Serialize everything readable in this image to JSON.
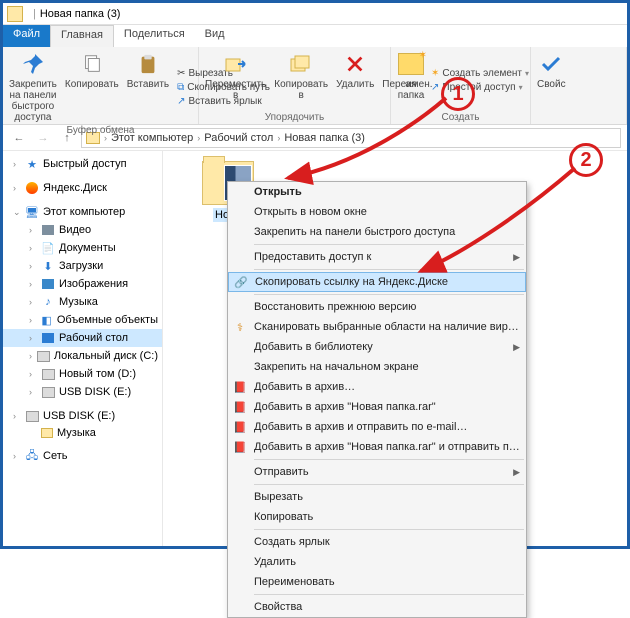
{
  "title": {
    "folder_name": "Новая папка (3)"
  },
  "tabs": {
    "file": "Файл",
    "home": "Главная",
    "share": "Поделиться",
    "view": "Вид"
  },
  "ribbon": {
    "clipboard": {
      "pin": "Закрепить на панели\nбыстрого доступа",
      "copy": "Копировать",
      "paste": "Вставить",
      "cut": "Вырезать",
      "copypath": "Скопировать путь",
      "pasteshort": "Вставить ярлык",
      "label": "Буфер обмена"
    },
    "organize": {
      "move": "Переместить\nв",
      "copyto": "Копировать\nв",
      "del": "Удалить",
      "rename": "Переимен.",
      "label": "Упорядочить"
    },
    "new": {
      "newfolder": "ая\nпапка",
      "newitem": "Создать элемент",
      "easyaccess": "Простой доступ",
      "label": "Создать"
    },
    "props": {
      "label": "Свойс"
    }
  },
  "breadcrumb": {
    "pc": "Этот компьютер",
    "desk": "Рабочий стол",
    "folder": "Новая папка (3)"
  },
  "sidebar": {
    "quick": "Быстрый доступ",
    "ydisk": "Яндекс.Диск",
    "pc": "Этот компьютер",
    "children": [
      "Видео",
      "Документы",
      "Загрузки",
      "Изображения",
      "Музыка",
      "Объемные объекты",
      "Рабочий стол",
      "Локальный диск (C:)",
      "Новый том (D:)",
      "USB DISK (E:)",
      "USB DISK (E:)",
      "Музыка"
    ],
    "network": "Сеть"
  },
  "content": {
    "folder_label": "Нова"
  },
  "ctx": {
    "open": "Открыть",
    "open_new": "Открыть в новом окне",
    "pin_quick": "Закрепить на панели быстрого доступа",
    "grant_access": "Предоставить доступ к",
    "copy_link_ydisk": "Скопировать ссылку на Яндекс.Диске",
    "restore": "Восстановить прежнюю версию",
    "scan_virus": "Сканировать выбранные области на наличие вирусов",
    "add_lib": "Добавить в библиотеку",
    "pin_start": "Закрепить на начальном экране",
    "add_arch": "Добавить в архив…",
    "add_arch_rar": "Добавить в архив \"Новая папка.rar\"",
    "add_arch_email": "Добавить в архив и отправить по e-mail…",
    "add_arch_rar_email": "Добавить в архив \"Новая папка.rar\" и отправить по e-mail",
    "send_to": "Отправить",
    "cut": "Вырезать",
    "copy": "Копировать",
    "create_shortcut": "Создать ярлык",
    "delete": "Удалить",
    "rename": "Переименовать",
    "props": "Свойства"
  },
  "anno": {
    "n1": "1",
    "n2": "2"
  }
}
